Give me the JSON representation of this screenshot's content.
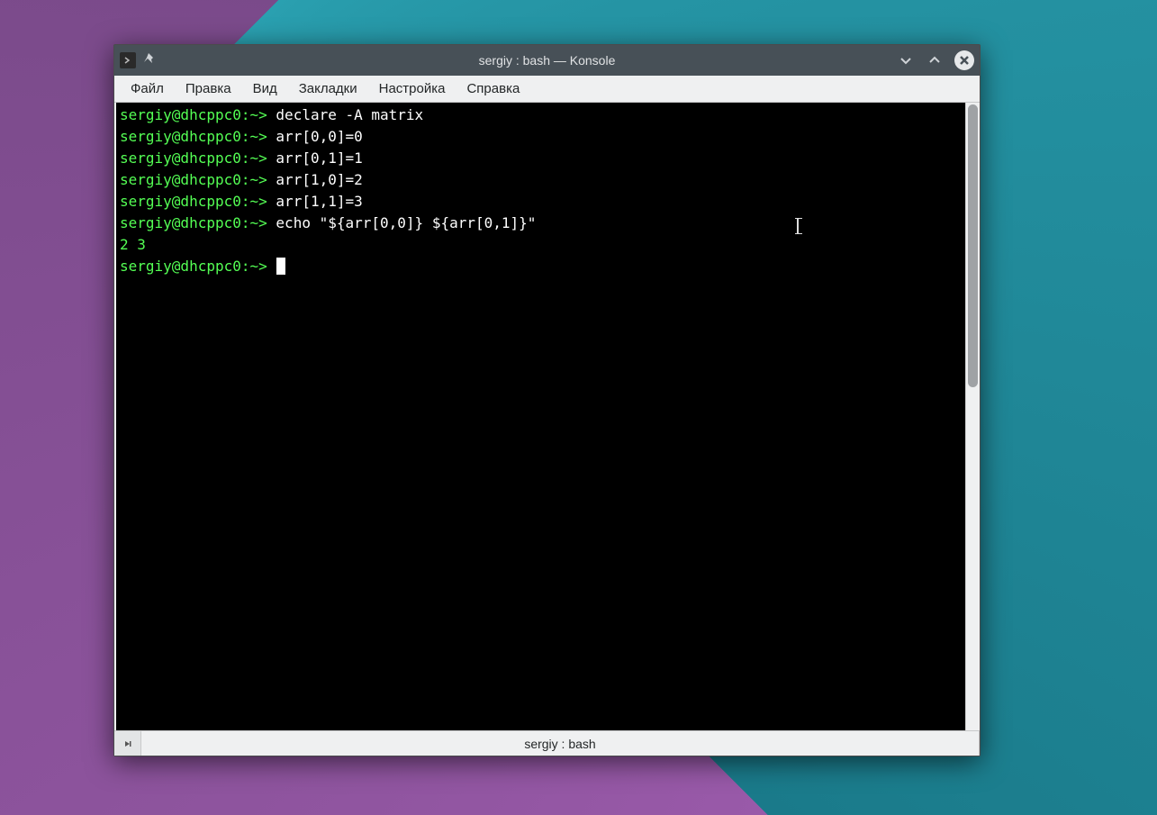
{
  "window": {
    "title": "sergiy : bash — Konsole"
  },
  "menu": {
    "file": "Файл",
    "edit": "Правка",
    "view": "Вид",
    "bookmarks": "Закладки",
    "settings": "Настройка",
    "help": "Справка"
  },
  "terminal": {
    "prompt_user": "sergiy@dhcppc0",
    "prompt_path": "~",
    "lines": [
      {
        "type": "cmd",
        "text": "declare -A matrix"
      },
      {
        "type": "cmd",
        "text": "arr[0,0]=0"
      },
      {
        "type": "cmd",
        "text": "arr[0,1]=1"
      },
      {
        "type": "cmd",
        "text": "arr[1,0]=2"
      },
      {
        "type": "cmd",
        "text": "arr[1,1]=3"
      },
      {
        "type": "cmd",
        "text": "echo \"${arr[0,0]} ${arr[0,1]}\""
      },
      {
        "type": "out",
        "text": "2 3"
      },
      {
        "type": "prompt_only"
      }
    ]
  },
  "tab": {
    "label": "sergiy : bash"
  }
}
